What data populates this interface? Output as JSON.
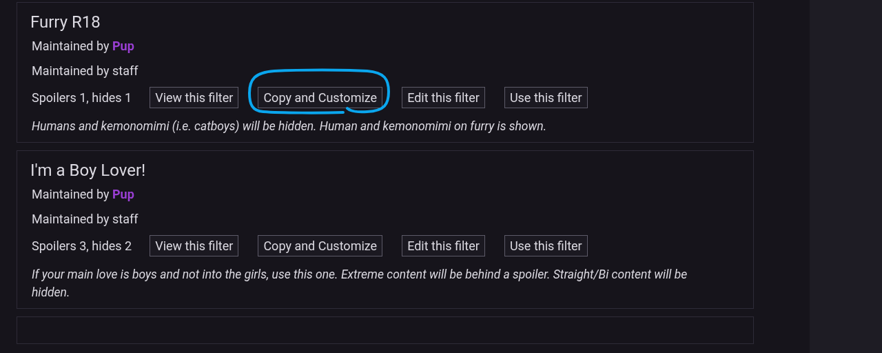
{
  "filters": [
    {
      "title": "Furry R18",
      "maintainers": [
        {
          "text": "Maintained by",
          "user": "Pup"
        },
        {
          "text": "Maintained by staff"
        }
      ],
      "summary": "Spoilers 1, hides 1",
      "buttons": [
        "View this filter",
        "Copy and Customize",
        "Edit this filter",
        "Use this filter"
      ],
      "description": "Humans and kemonomimi (i.e. catboys) will be hidden. Human and kemonomimi on furry is shown.",
      "annotated": true
    },
    {
      "title": "I'm a Boy Lover!",
      "maintainers": [
        {
          "text": "Maintained by",
          "user": "Pup"
        },
        {
          "text": "Maintained by staff"
        }
      ],
      "summary": "Spoilers 3, hides 2",
      "buttons": [
        "View this filter",
        "Copy and Customize",
        "Edit this filter",
        "Use this filter"
      ],
      "description": "If your main love is boys and not into the girls, use this one. Extreme content will be behind a spoiler. Straight/Bi content will be hidden.",
      "annotated": false
    }
  ]
}
